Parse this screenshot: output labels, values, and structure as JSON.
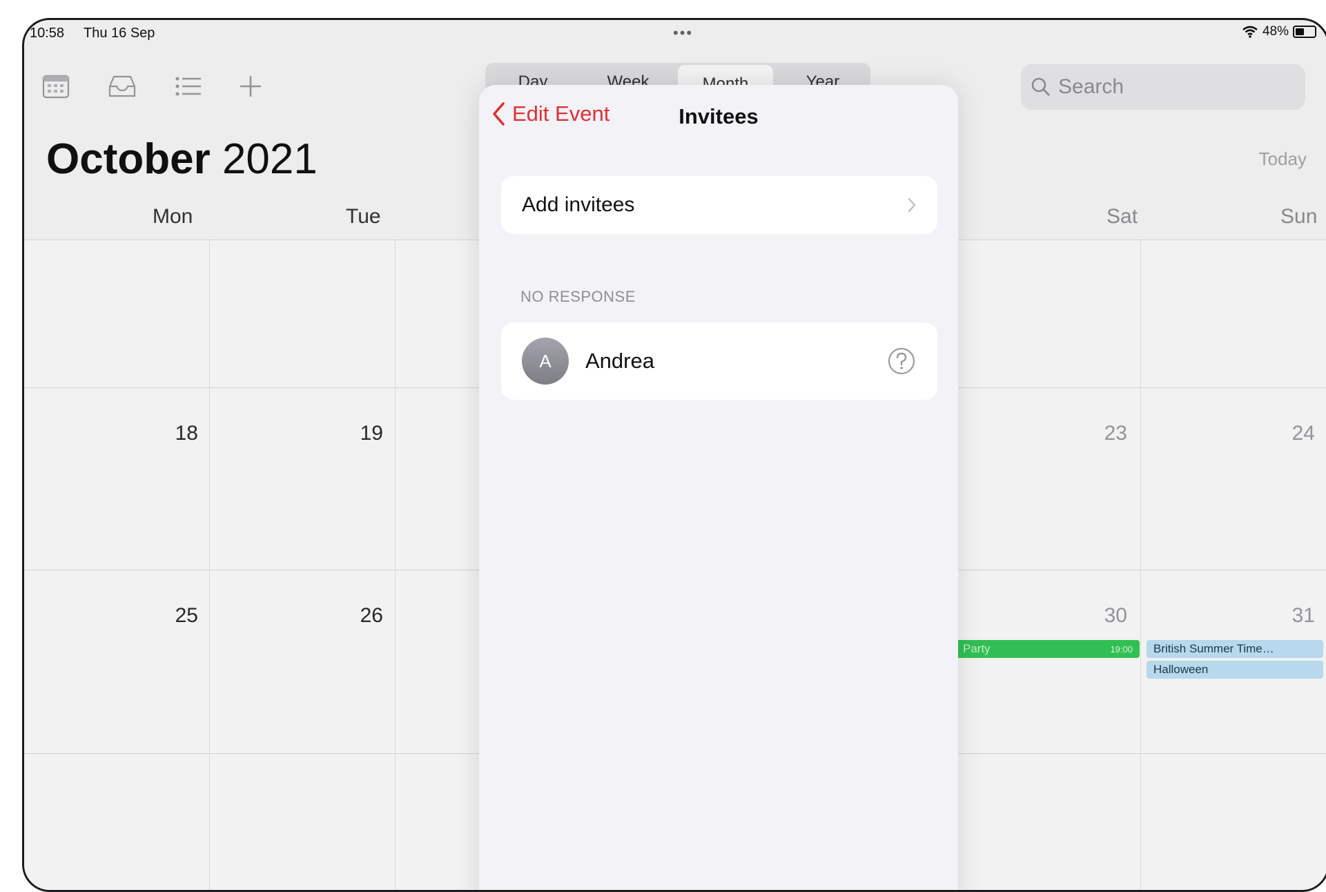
{
  "status_bar": {
    "time": "10:58",
    "date": "Thu 16 Sep",
    "battery": "48%"
  },
  "toolbar": {
    "icons": [
      "calendar-icon",
      "inbox-icon",
      "list-icon",
      "plus-icon"
    ],
    "search_placeholder": "Search",
    "today": "Today"
  },
  "view_tabs": [
    {
      "label": "Day"
    },
    {
      "label": "Week"
    },
    {
      "label": "Month",
      "selected": true
    },
    {
      "label": "Year"
    }
  ],
  "month_title": {
    "month": "October",
    "year": "2021"
  },
  "weekdays": [
    "Mon",
    "Tue",
    "Sat",
    "Sun"
  ],
  "weeks": [
    {
      "mon": "",
      "tue": "",
      "sat": "",
      "sun": ""
    },
    {
      "mon": "18",
      "tue": "19",
      "sat": "23",
      "sun": "24"
    },
    {
      "mon": "25",
      "tue": "26",
      "sat": "30",
      "sun": "31"
    },
    {
      "mon": "",
      "tue": "",
      "sat": "",
      "sun": ""
    }
  ],
  "events": {
    "sat30": {
      "title": "Party",
      "time": "19:00",
      "color": "#34c759"
    },
    "sun31": [
      {
        "title": "British Summer Time…",
        "color": "#bfe1f7"
      },
      {
        "title": "Halloween",
        "color": "#bfe1f7"
      }
    ]
  },
  "sheet": {
    "back_label": "Edit Event",
    "title": "Invitees",
    "add_label": "Add invitees",
    "section_header": "NO RESPONSE",
    "invitees": [
      {
        "initial": "A",
        "name": "Andrea",
        "status_icon": "question-circle-icon"
      }
    ]
  },
  "colors": {
    "accent_red": "#e03131",
    "event_green": "#34c759",
    "event_blue": "#bfe1f7"
  }
}
